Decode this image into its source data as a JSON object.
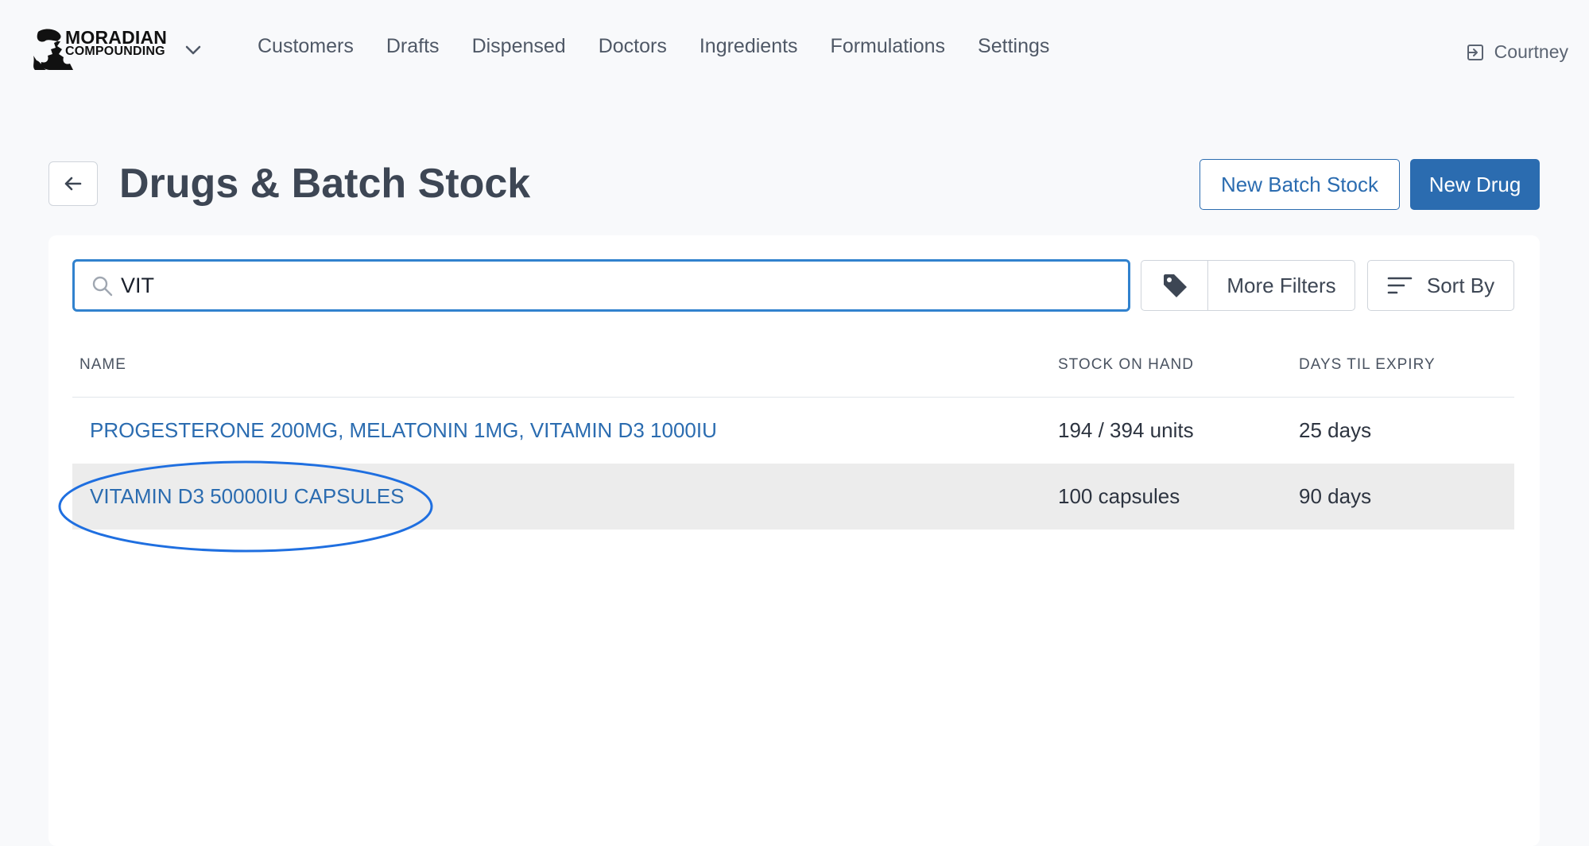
{
  "brand": {
    "line1": "MORADIAN",
    "line2": "COMPOUNDING"
  },
  "nav": {
    "items": [
      {
        "label": "Customers"
      },
      {
        "label": "Drafts"
      },
      {
        "label": "Dispensed"
      },
      {
        "label": "Doctors"
      },
      {
        "label": "Ingredients"
      },
      {
        "label": "Formulations"
      },
      {
        "label": "Settings"
      }
    ],
    "user_name": "Courtney"
  },
  "page": {
    "title": "Drugs & Batch Stock",
    "new_batch_label": "New Batch Stock",
    "new_drug_label": "New Drug"
  },
  "filters": {
    "search_value": "VIT",
    "more_filters_label": "More Filters",
    "sort_label": "Sort By"
  },
  "table": {
    "columns": {
      "name": "NAME",
      "stock": "STOCK ON HAND",
      "expiry": "DAYS TIL EXPIRY"
    },
    "rows": [
      {
        "name": "PROGESTERONE 200MG, MELATONIN 1MG, VITAMIN D3 1000IU",
        "stock": "194 / 394 units",
        "expiry": "25 days"
      },
      {
        "name": "VITAMIN D3 50000IU CAPSULES",
        "stock": "100 capsules",
        "expiry": "90 days"
      }
    ]
  },
  "colors": {
    "accent": "#2b6cb0",
    "search_focus": "#3182ce",
    "selected_row": "#ececec",
    "annotation": "#1f6fe0"
  }
}
